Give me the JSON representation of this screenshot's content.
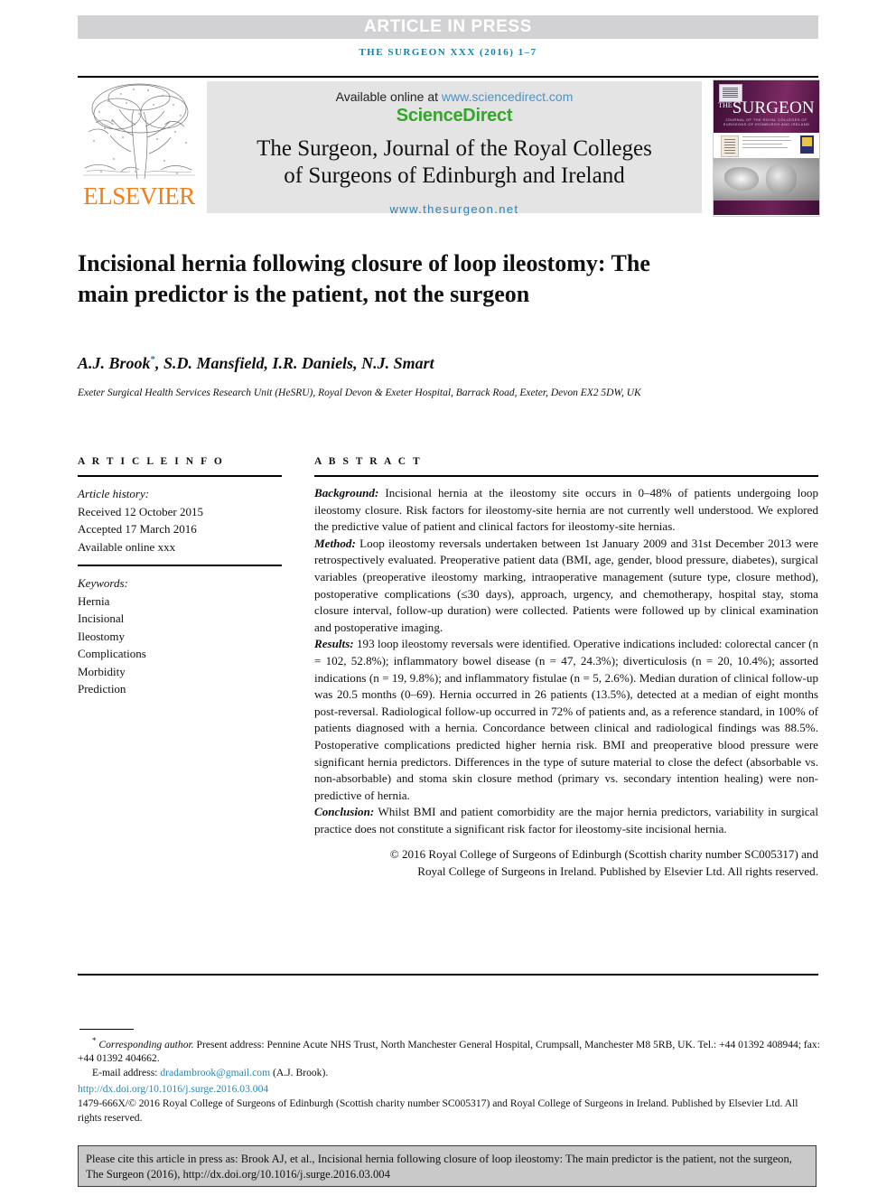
{
  "banner": {
    "article_in_press": "ARTICLE IN PRESS"
  },
  "running_head": "THE SURGEON XXX (2016) 1–7",
  "masthead": {
    "elsevier_wordmark": "ELSEVIER",
    "available_online_prefix": "Available online at ",
    "sciencedirect_url": "www.sciencedirect.com",
    "sciencedirect_brand": "ScienceDirect",
    "journal_title_line1": "The Surgeon, Journal of the Royal Colleges",
    "journal_title_line2": "of Surgeons of Edinburgh and Ireland",
    "journal_url": "www.thesurgeon.net",
    "cover": {
      "the": "THE",
      "title": "SURGEON",
      "subtitle": "JOURNAL OF THE ROYAL COLLEGES OF SURGEONS OF EDINBURGH AND IRELAND"
    }
  },
  "article": {
    "title": "Incisional hernia following closure of loop ileostomy: The main predictor is the patient, not the surgeon",
    "authors": "A.J. Brook",
    "authors_rest": ", S.D. Mansfield, I.R. Daniels, N.J. Smart",
    "corresponding_marker": "*",
    "affiliation": "Exeter Surgical Health Services Research Unit (HeSRU), Royal Devon & Exeter Hospital, Barrack Road, Exeter, Devon EX2 5DW, UK"
  },
  "article_info": {
    "heading": "A R T I C L E   I N F O",
    "history_label": "Article history:",
    "received": "Received 12 October 2015",
    "accepted": "Accepted 17 March 2016",
    "available_online": "Available online xxx",
    "keywords_label": "Keywords:",
    "keywords": [
      "Hernia",
      "Incisional",
      "Ileostomy",
      "Complications",
      "Morbidity",
      "Prediction"
    ]
  },
  "abstract": {
    "heading": "A B S T R A C T",
    "sections": [
      {
        "label": "Background:",
        "text": " Incisional hernia at the ileostomy site occurs in 0–48% of patients undergoing loop ileostomy closure. Risk factors for ileostomy-site hernia are not currently well understood. We explored the predictive value of patient and clinical factors for ileostomy-site hernias."
      },
      {
        "label": "Method:",
        "text": " Loop ileostomy reversals undertaken between 1st January 2009 and 31st December 2013 were retrospectively evaluated. Preoperative patient data (BMI, age, gender, blood pressure, diabetes), surgical variables (preoperative ileostomy marking, intraoperative management (suture type, closure method), postoperative complications (≤30 days), approach, urgency, and chemotherapy, hospital stay, stoma closure interval, follow-up duration) were collected. Patients were followed up by clinical examination and postoperative imaging."
      },
      {
        "label": "Results:",
        "text": " 193 loop ileostomy reversals were identified. Operative indications included: colorectal cancer (n = 102, 52.8%); inflammatory bowel disease (n = 47, 24.3%); diverticulosis (n = 20, 10.4%); assorted indications (n = 19, 9.8%); and inflammatory fistulae (n = 5, 2.6%). Median duration of clinical follow-up was 20.5 months (0–69). Hernia occurred in 26 patients (13.5%), detected at a median of eight months post-reversal. Radiological follow-up occurred in 72% of patients and, as a reference standard, in 100% of patients diagnosed with a hernia. Concordance between clinical and radiological findings was 88.5%. Postoperative complications predicted higher hernia risk. BMI and preoperative blood pressure were significant hernia predictors. Differences in the type of suture material to close the defect (absorbable vs. non-absorbable) and stoma skin closure method (primary vs. secondary intention healing) were non-predictive of hernia."
      },
      {
        "label": "Conclusion:",
        "text": " Whilst BMI and patient comorbidity are the major hernia predictors, variability in surgical practice does not constitute a significant risk factor for ileostomy-site incisional hernia."
      }
    ],
    "copyright_line1": "© 2016 Royal College of Surgeons of Edinburgh (Scottish charity number SC005317) and",
    "copyright_line2": "Royal College of Surgeons in Ireland. Published by Elsevier Ltd. All rights reserved."
  },
  "footnotes": {
    "corresponding_marker": "*",
    "corresponding_label": "Corresponding author.",
    "corresponding_text": " Present address: Pennine Acute NHS Trust, North Manchester General Hospital, Crumpsall, Manchester M8 5RB, UK. Tel.: +44 01392 408944; fax: +44 01392 404662.",
    "email_label": "E-mail address:",
    "email": "dradambrook@gmail.com",
    "email_attrib": "(A.J. Brook).",
    "doi": "http://dx.doi.org/10.1016/j.surge.2016.03.004",
    "issn_line": "1479-666X/© 2016 Royal College of Surgeons of Edinburgh (Scottish charity number SC005317) and Royal College of Surgeons in Ireland. Published by Elsevier Ltd. All rights reserved."
  },
  "citation_box": {
    "text": "Please cite this article in press as: Brook AJ, et al., Incisional hernia following closure of loop ileostomy: The main predictor is the patient, not the surgeon, The Surgeon (2016), http://dx.doi.org/10.1016/j.surge.2016.03.004"
  },
  "colors": {
    "banner_gray": "#d2d2d4",
    "journal_teal": "#1a7fa8",
    "sciencedirect_green": "#34a62a",
    "elsevier_orange": "#f07f18",
    "link_blue": "#2a86b5",
    "cover_purple": "#5b1a4c",
    "cite_box_gray": "#c9c9c9"
  }
}
